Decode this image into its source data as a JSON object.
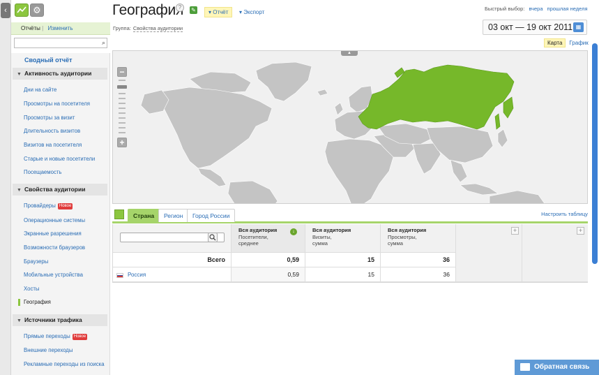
{
  "sidebar": {
    "tabs": {
      "reports": "Отчёты",
      "change": "Изменить"
    },
    "summary": "Сводный отчёт",
    "sections": [
      {
        "title": "Активность аудитории",
        "items": [
          "Дни на сайте",
          "Просмотры на посетителя",
          "Просмотры за визит",
          "Длительность визитов",
          "Визитов на посетителя",
          "Старые и новые посетители",
          "Посещаемость"
        ]
      },
      {
        "title": "Свойства аудитории",
        "items": [
          "Провайдеры",
          "Операционные системы",
          "Экранные разрешения",
          "Возможности браузеров",
          "Браузеры",
          "Мобильные устройства",
          "Хосты",
          "География"
        ]
      },
      {
        "title": "Источники трафика",
        "items": [
          "Прямые переходы",
          "Внешние переходы",
          "Рекламные переходы из поиска"
        ]
      }
    ],
    "badge_new": "Новое"
  },
  "header": {
    "title": "География",
    "help": "?",
    "report_btn": "▾ Отчёт",
    "export_link": "▾ Экспорт",
    "group_label": "Группа:",
    "group_value": "Свойства аудитории",
    "quick_select_label": "Быстрый выбор:",
    "quick_yesterday": "вчера",
    "quick_last_week": "прошлая неделя",
    "date_range": "03 окт — 19 окт 2011",
    "view_map": "Карта",
    "view_graph": "График"
  },
  "tabs": {
    "items": [
      "Страна",
      "Регион",
      "Город России"
    ],
    "config": "Настроить таблицу"
  },
  "table": {
    "columns": [
      {
        "title": "Вся аудитория",
        "sub1": "Посетители,",
        "sub2": "среднее"
      },
      {
        "title": "Вся аудитория",
        "sub1": "Визиты,",
        "sub2": "сумма"
      },
      {
        "title": "Вся аудитория",
        "sub1": "Просмотры,",
        "sub2": "сумма"
      }
    ],
    "total_label": "Всего",
    "totals": [
      "0,59",
      "15",
      "36"
    ],
    "rows": [
      {
        "name": "Россия",
        "values": [
          "0,59",
          "15",
          "36"
        ]
      }
    ]
  },
  "feedback": "Обратная связь",
  "colors": {
    "accent_green": "#8cc63f",
    "land_gray": "#c4c4c4",
    "highlight_country": "#76b82a",
    "link_blue": "#2a6db5"
  }
}
